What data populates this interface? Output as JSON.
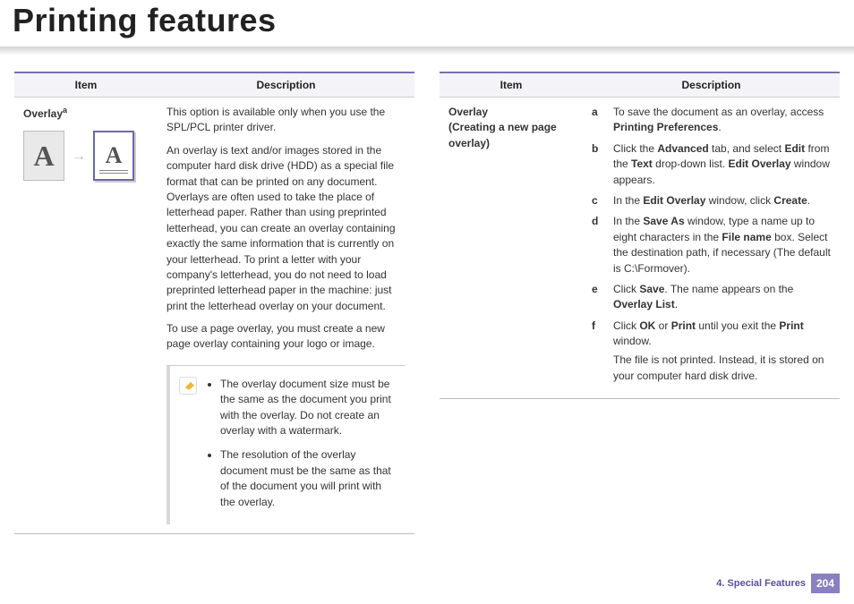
{
  "title": "Printing features",
  "table_headers": {
    "item": "Item",
    "description": "Description"
  },
  "left": {
    "item_label": "Overlay",
    "item_footnote": "a",
    "para1": "This option is available only when you use the SPL/PCL printer driver.",
    "para2": "An overlay is text and/or images stored in the computer hard disk drive (HDD) as a special file format that can be printed on any document. Overlays are often used to take the place of letterhead paper. Rather than using preprinted letterhead, you can create an overlay containing exactly the same information that is currently on your letterhead. To print a letter with your company's letterhead, you do not need to load preprinted letterhead paper in the machine: just print the letterhead overlay on your document.",
    "para3": "To use a page overlay, you must create a new page overlay containing your logo or image.",
    "notes": [
      "The overlay document size must be the same as the document you print with the overlay. Do not create an overlay with a watermark.",
      "The resolution of the overlay document must be the same as that of the document you will print with the overlay."
    ]
  },
  "right": {
    "item_label": "Overlay",
    "item_sub_open": "(",
    "item_sub_bold": "Creating a new page overlay",
    "item_sub_close": ")",
    "steps": [
      {
        "m": "a",
        "pre": "To save the document as an overlay, access ",
        "b1": "Printing Preferences",
        "post": "."
      },
      {
        "m": "b",
        "pre": "Click the ",
        "b1": "Advanced",
        "mid1": " tab, and select ",
        "b2": "Edit",
        "mid2": " from the ",
        "b3": "Text",
        "mid3": " drop-down list. ",
        "b4": "Edit Overlay",
        "post": " window appears."
      },
      {
        "m": "c",
        "pre": "In the ",
        "b1": "Edit Overlay",
        "mid1": " window, click ",
        "b2": "Create",
        "post": "."
      },
      {
        "m": "d",
        "pre": "In the ",
        "b1": "Save As",
        "mid1": " window, type a name up to eight characters in the ",
        "b2": "File name",
        "post": " box. Select the destination path, if necessary (The default is C:\\Formover)."
      },
      {
        "m": "e",
        "pre": "Click ",
        "b1": "Save",
        "mid1": ". The name appears on the ",
        "b2": "Overlay List",
        "post": "."
      },
      {
        "m": "f",
        "pre": "Click ",
        "b1": "OK",
        "mid1": " or ",
        "b2": "Print",
        "mid2": " until you exit the ",
        "b3": "Print",
        "post": " window.",
        "extra": "The file is not printed. Instead, it is stored on your computer hard disk drive."
      }
    ]
  },
  "footer": {
    "chapter": "4.  Special Features",
    "page": "204"
  }
}
